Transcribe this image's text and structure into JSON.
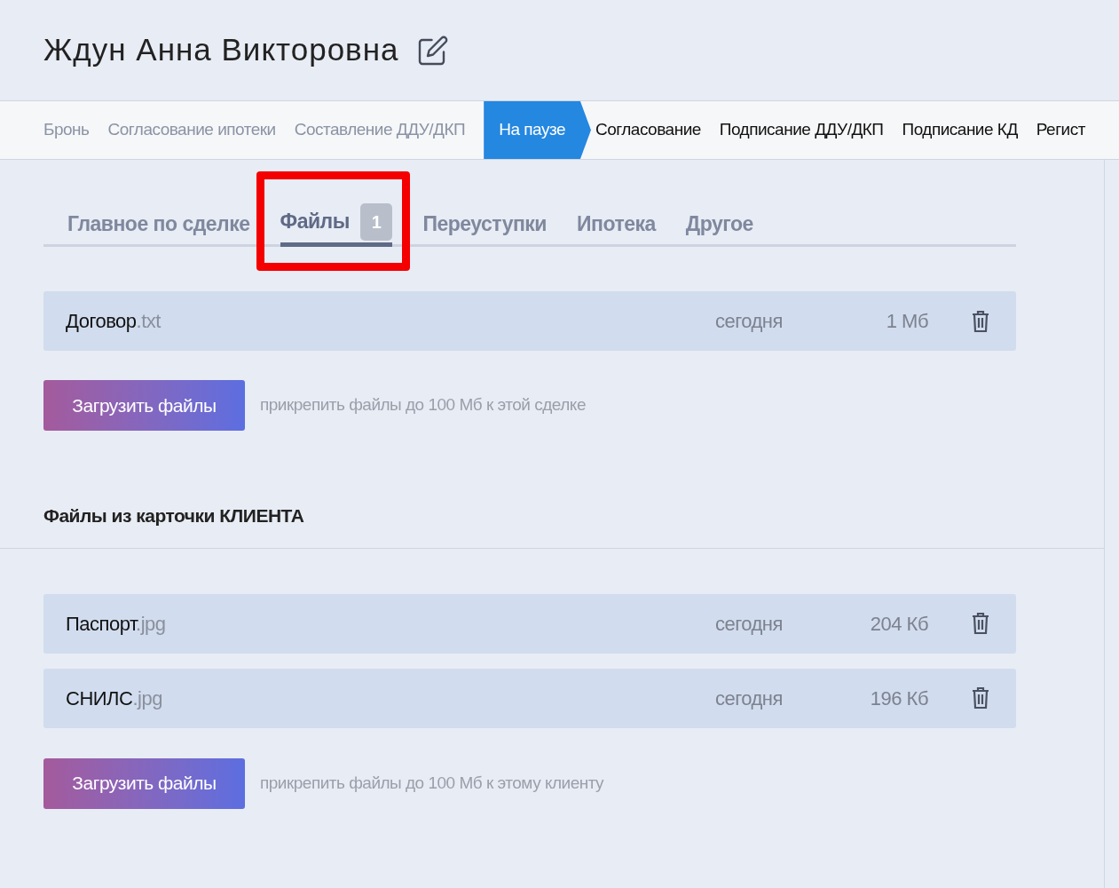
{
  "title": "Ждун Анна Викторовна",
  "stages": [
    {
      "label": "Бронь",
      "kind": "done"
    },
    {
      "label": "Согласование ипотеки",
      "kind": "done"
    },
    {
      "label": "Составление ДДУ/ДКП",
      "kind": "done"
    },
    {
      "label": "На паузе",
      "kind": "current"
    },
    {
      "label": "Согласование",
      "kind": "upcoming"
    },
    {
      "label": "Подписание ДДУ/ДКП",
      "kind": "upcoming"
    },
    {
      "label": "Подписание КД",
      "kind": "upcoming"
    },
    {
      "label": "Регист",
      "kind": "upcoming"
    }
  ],
  "tabs": [
    {
      "label": "Главное по сделке",
      "selected": false,
      "highlighted": false
    },
    {
      "label": "Файлы",
      "badge": "1",
      "selected": true,
      "highlighted": true
    },
    {
      "label": "Переуступки",
      "selected": false,
      "highlighted": false
    },
    {
      "label": "Ипотека",
      "selected": false,
      "highlighted": false
    },
    {
      "label": "Другое",
      "selected": false,
      "highlighted": false
    }
  ],
  "deal_files": {
    "files": [
      {
        "name": "Договор",
        "ext": ".txt",
        "date": "сегодня",
        "size": "1 Мб"
      }
    ],
    "upload_button": "Загрузить файлы",
    "hint": "прикрепить файлы до 100 Мб к этой сделке"
  },
  "client_files": {
    "heading": "Файлы из карточки КЛИЕНТА",
    "files": [
      {
        "name": "Паспорт",
        "ext": ".jpg",
        "date": "сегодня",
        "size": "204 Кб"
      },
      {
        "name": "СНИЛС",
        "ext": ".jpg",
        "date": "сегодня",
        "size": "196 Кб"
      }
    ],
    "upload_button": "Загрузить файлы",
    "hint": "прикрепить файлы до 100 Мб к этому клиенту"
  }
}
